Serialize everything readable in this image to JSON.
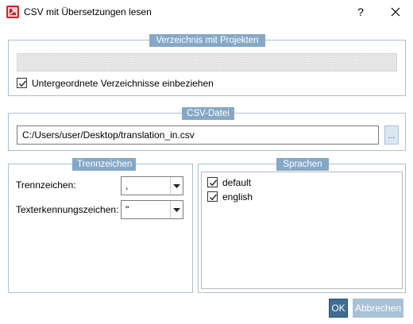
{
  "window": {
    "title": "CSV mit Übersetzungen lesen",
    "help_glyph": "?",
    "app_icon": "app-logo-icon",
    "close_icon": "close-icon"
  },
  "directory_group": {
    "title": "Verzeichnis mit Projekten",
    "path_value": "",
    "include_subdirs_label": "Untergeordnete Verzeichnisse einbeziehen",
    "include_subdirs_checked": true
  },
  "csv_group": {
    "title": "CSV-Datei",
    "path_value": "C:/Users/user/Desktop/translation_in.csv",
    "browse_label": "..."
  },
  "separator_group": {
    "title": "Trennzeichen",
    "separator_label": "Trennzeichen:",
    "separator_value": ",",
    "text_qualifier_label": "Texterkennungszeichen:",
    "text_qualifier_value": "\""
  },
  "languages_group": {
    "title": "Sprachen",
    "items": [
      {
        "label": "default",
        "checked": true
      },
      {
        "label": "english",
        "checked": true
      }
    ]
  },
  "buttons": {
    "ok": "OK",
    "cancel": "Abbrechen"
  },
  "colors": {
    "group_header": "#86a8c6",
    "primary_button": "#3e6d93",
    "disabled_button": "#a9c1d6",
    "app_icon": "#c8262c"
  }
}
